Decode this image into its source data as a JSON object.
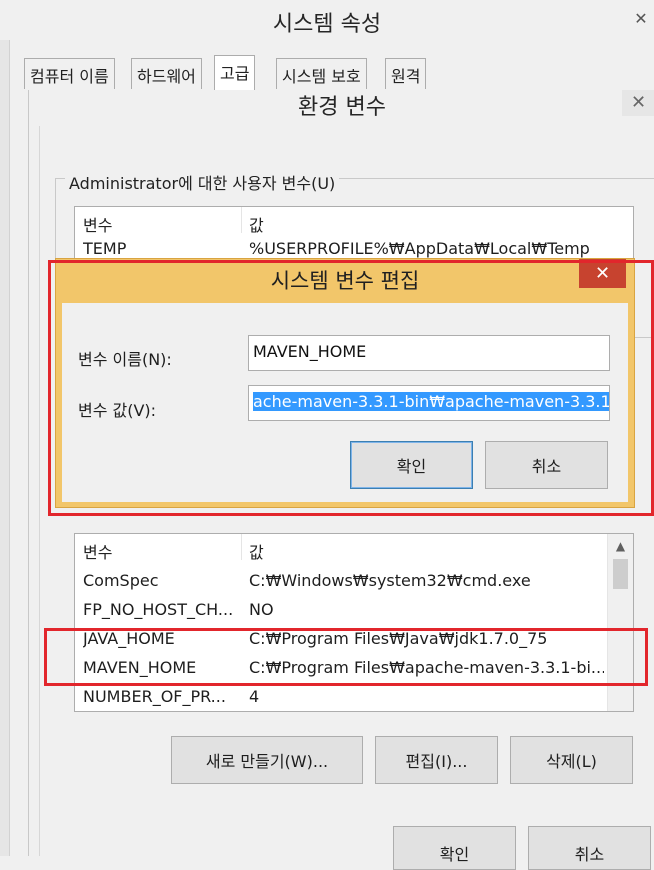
{
  "system_properties": {
    "title": "시스템 속성",
    "tabs": [
      {
        "label": "컴퓨터 이름"
      },
      {
        "label": "하드웨어"
      },
      {
        "label": "고급",
        "active": true
      },
      {
        "label": "시스템 보호"
      },
      {
        "label": "원격"
      }
    ]
  },
  "env_dialog": {
    "title": "환경 변수",
    "close_glyph": "✕",
    "user_vars": {
      "group_label": "Administrator에 대한 사용자 변수(U)",
      "columns": [
        "변수",
        "값"
      ],
      "rows": [
        {
          "name": "TEMP",
          "value": "%USERPROFILE%₩AppData₩Local₩Temp"
        }
      ]
    },
    "system_vars": {
      "columns": [
        "변수",
        "값"
      ],
      "rows": [
        {
          "name": "ComSpec",
          "value": "C:₩Windows₩system32₩cmd.exe"
        },
        {
          "name": "FP_NO_HOST_CH...",
          "value": "NO"
        },
        {
          "name": "JAVA_HOME",
          "value": "C:₩Program Files₩Java₩jdk1.7.0_75"
        },
        {
          "name": "MAVEN_HOME",
          "value": "C:₩Program Files₩apache-maven-3.3.1-bi..."
        },
        {
          "name": "NUMBER_OF_PR...",
          "value": "4"
        }
      ],
      "buttons": {
        "new": "새로 만들기(W)...",
        "edit": "편집(I)...",
        "delete": "삭제(L)"
      }
    },
    "footer_buttons": {
      "ok": "확인",
      "cancel": "취소"
    }
  },
  "edit_dialog": {
    "title": "시스템 변수 편집",
    "close_glyph": "✕",
    "name_label": "변수 이름(N):",
    "name_value": "MAVEN_HOME",
    "value_label": "변수 값(V):",
    "value_value": "ache-maven-3.3.1-bin₩apache-maven-3.3.1",
    "ok": "확인",
    "cancel": "취소"
  },
  "colors": {
    "edit_dialog_frame": "#f2c66a",
    "close_button": "#c7432f",
    "highlight_red": "#e2262c",
    "selection": "#3399ff"
  }
}
